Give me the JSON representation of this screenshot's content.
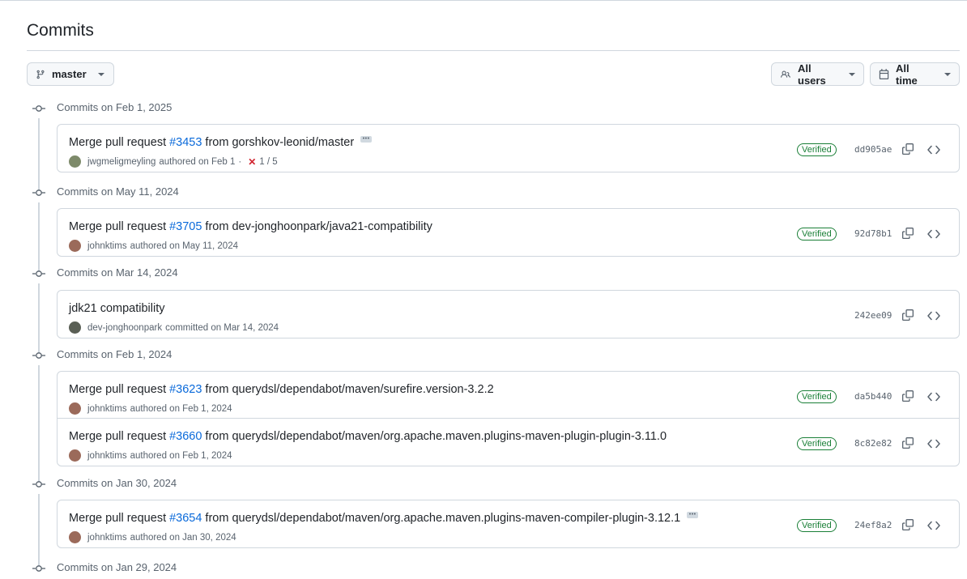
{
  "page": {
    "title": "Commits"
  },
  "filters": {
    "branch": "master",
    "users": "All users",
    "time": "All time"
  },
  "colors": {
    "link": "#0969da",
    "verified": "#1a7f37",
    "fail": "#d1242f",
    "border": "#d0d7de"
  },
  "groups": [
    {
      "label": "Commits on Feb 1, 2025",
      "commits": [
        {
          "prefix": "Merge pull request",
          "pr": "#3453",
          "suffix": "from gorshkov-leonid/master",
          "ellipsis": true,
          "author": "jwgmeligmeyling",
          "action": "authored on Feb 1",
          "sep": "·",
          "checks": "1 / 5",
          "verified": "Verified",
          "sha": "dd905ae",
          "avatar_color": "#7d8a6a"
        }
      ]
    },
    {
      "label": "Commits on May 11, 2024",
      "commits": [
        {
          "prefix": "Merge pull request",
          "pr": "#3705",
          "suffix": "from dev-jonghoonpark/java21-compatibility",
          "author": "johnktims",
          "action": "authored on May 11, 2024",
          "verified": "Verified",
          "sha": "92d78b1",
          "avatar_color": "#9b6a5a"
        }
      ]
    },
    {
      "label": "Commits on Mar 14, 2024",
      "commits": [
        {
          "prefix": "jdk21 compatibility",
          "pr": "",
          "suffix": "",
          "author": "dev-jonghoonpark",
          "action": "committed on Mar 14, 2024",
          "verified": "",
          "sha": "242ee09",
          "avatar_color": "#5a5f55"
        }
      ]
    },
    {
      "label": "Commits on Feb 1, 2024",
      "commits": [
        {
          "prefix": "Merge pull request",
          "pr": "#3623",
          "suffix": "from querydsl/dependabot/maven/surefire.version-3.2.2",
          "author": "johnktims",
          "action": "authored on Feb 1, 2024",
          "verified": "Verified",
          "sha": "da5b440",
          "avatar_color": "#9b6a5a"
        },
        {
          "prefix": "Merge pull request",
          "pr": "#3660",
          "suffix": "from querydsl/dependabot/maven/org.apache.maven.plugins-maven-plugin-plugin-3.11.0",
          "author": "johnktims",
          "action": "authored on Feb 1, 2024",
          "verified": "Verified",
          "sha": "8c82e82",
          "avatar_color": "#9b6a5a"
        }
      ]
    },
    {
      "label": "Commits on Jan 30, 2024",
      "commits": [
        {
          "prefix": "Merge pull request",
          "pr": "#3654",
          "suffix": "from querydsl/dependabot/maven/org.apache.maven.plugins-maven-compiler-plugin-3.12.1",
          "ellipsis": true,
          "author": "johnktims",
          "action": "authored on Jan 30, 2024",
          "verified": "Verified",
          "sha": "24ef8a2",
          "avatar_color": "#9b6a5a"
        }
      ]
    },
    {
      "label": "Commits on Jan 29, 2024",
      "commits": []
    }
  ]
}
